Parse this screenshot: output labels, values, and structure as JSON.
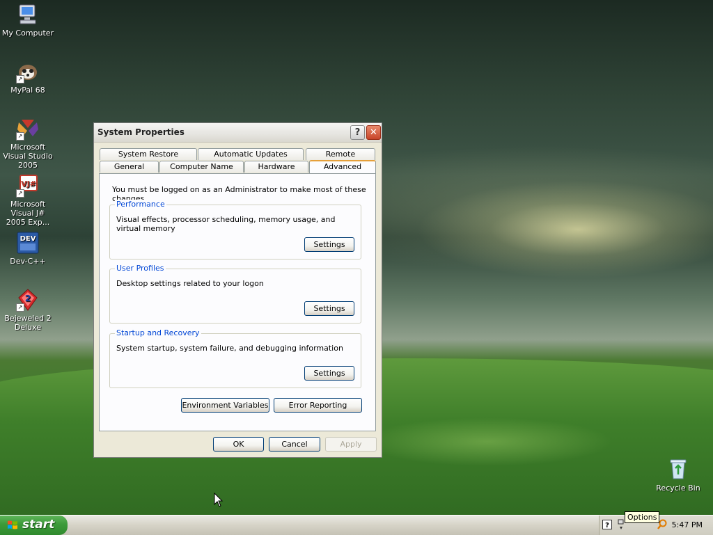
{
  "desktop": {
    "icons": [
      {
        "label": "My Computer",
        "icon": "my-computer-icon"
      },
      {
        "label": "MyPal 68",
        "icon": "mypal-icon"
      },
      {
        "label": "Microsoft Visual Studio 2005",
        "icon": "visual-studio-icon"
      },
      {
        "label": "Microsoft Visual J# 2005 Exp...",
        "icon": "visual-jsharp-icon"
      },
      {
        "label": "Dev-C++",
        "icon": "devcpp-icon"
      },
      {
        "label": "Bejeweled 2 Deluxe",
        "icon": "bejeweled-icon"
      },
      {
        "label": "Recycle Bin",
        "icon": "recycle-bin-icon"
      }
    ]
  },
  "window": {
    "title": "System Properties",
    "help": "?",
    "close": "✕",
    "tabs_row1": [
      "System Restore",
      "Automatic Updates",
      "Remote"
    ],
    "tabs_row2": [
      "General",
      "Computer Name",
      "Hardware",
      "Advanced"
    ],
    "active_tab": "Advanced",
    "note": "You must be logged on as an Administrator to make most of these changes.",
    "groups": [
      {
        "title": "Performance",
        "desc": "Visual effects, processor scheduling, memory usage, and virtual memory",
        "button": "Settings"
      },
      {
        "title": "User Profiles",
        "desc": "Desktop settings related to your logon",
        "button": "Settings"
      },
      {
        "title": "Startup and Recovery",
        "desc": "System startup, system failure, and debugging information",
        "button": "Settings"
      }
    ],
    "env_button": "Environment Variables",
    "error_button": "Error Reporting",
    "ok": "OK",
    "cancel": "Cancel",
    "apply": "Apply"
  },
  "taskbar": {
    "start": "start",
    "clock": "5:47 PM",
    "tooltip": "Options"
  }
}
